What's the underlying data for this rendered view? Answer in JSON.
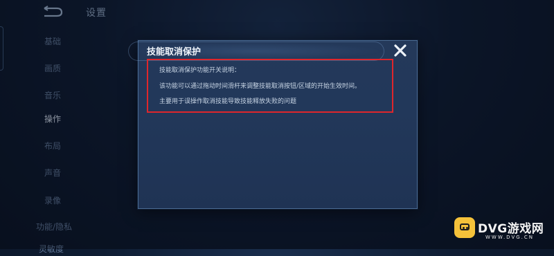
{
  "header": {
    "title": "设置"
  },
  "sidebar": {
    "items": [
      {
        "label": "基础"
      },
      {
        "label": "画质"
      },
      {
        "label": "音乐"
      },
      {
        "label": "操作",
        "active": true
      },
      {
        "label": "布局"
      },
      {
        "label": "声音"
      },
      {
        "label": "录像"
      },
      {
        "label": "功能/隐私"
      },
      {
        "label": "灵敏度"
      }
    ]
  },
  "modal": {
    "title": "技能取消保护",
    "lines": [
      "技能取消保护功能开关说明：",
      "该功能可以通过拖动时间滑杆来调整技能取消按钮/区域的开始生效时间。",
      "主要用于误操作取消技能导致技能释放失败的问题"
    ]
  },
  "watermark": {
    "text": "DVG游戏网",
    "url": "WWW.DVG.CN"
  },
  "colors": {
    "highlight": "#e0262b",
    "modal_bg": "#22385a",
    "watermark": "#f5c23a"
  }
}
